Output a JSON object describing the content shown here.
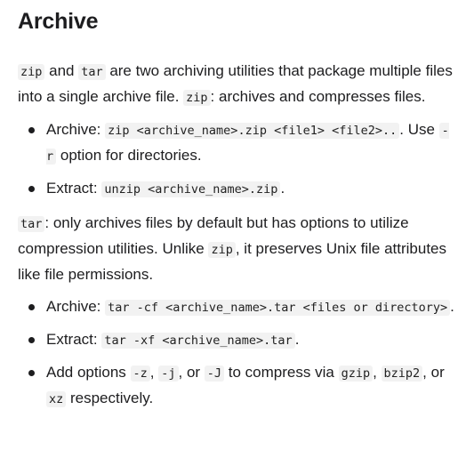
{
  "heading": "Archive",
  "intro": {
    "zip": "zip",
    "and": " and ",
    "tar": "tar",
    "text1": " are two archiving utilities that package multiple files into a single archive file. ",
    "zip2": "zip",
    "text2": ": archives and compresses files."
  },
  "zip_list": {
    "archive": {
      "label": "Archive: ",
      "cmd": "zip <archive_name>.zip <file1> <file2>..",
      "mid": ". Use ",
      "opt": "-r",
      "tail": " option for directories."
    },
    "extract": {
      "label": "Extract: ",
      "cmd": "unzip <archive_name>.zip",
      "tail": "."
    }
  },
  "tar_para": {
    "tar": "tar",
    "text1": ": only archives files by default but has options to utilize compression utilities. Unlike ",
    "zip": "zip",
    "text2": ", it preserves Unix file attributes like file permissions."
  },
  "tar_list": {
    "archive": {
      "label": "Archive: ",
      "cmd": "tar -cf <archive_name>.tar <files or directory>",
      "tail": "."
    },
    "extract": {
      "label": "Extract: ",
      "cmd": "tar -xf <archive_name>.tar",
      "tail": "."
    },
    "options": {
      "label": "Add options ",
      "z": "-z",
      "sep1": ", ",
      "j": "-j",
      "sep2": ", or ",
      "J": "-J",
      "mid": " to compress via ",
      "gzip": "gzip",
      "sep3": ", ",
      "bzip2": "bzip2",
      "sep4": ", or ",
      "xz": "xz",
      "tail": " respectively."
    }
  }
}
